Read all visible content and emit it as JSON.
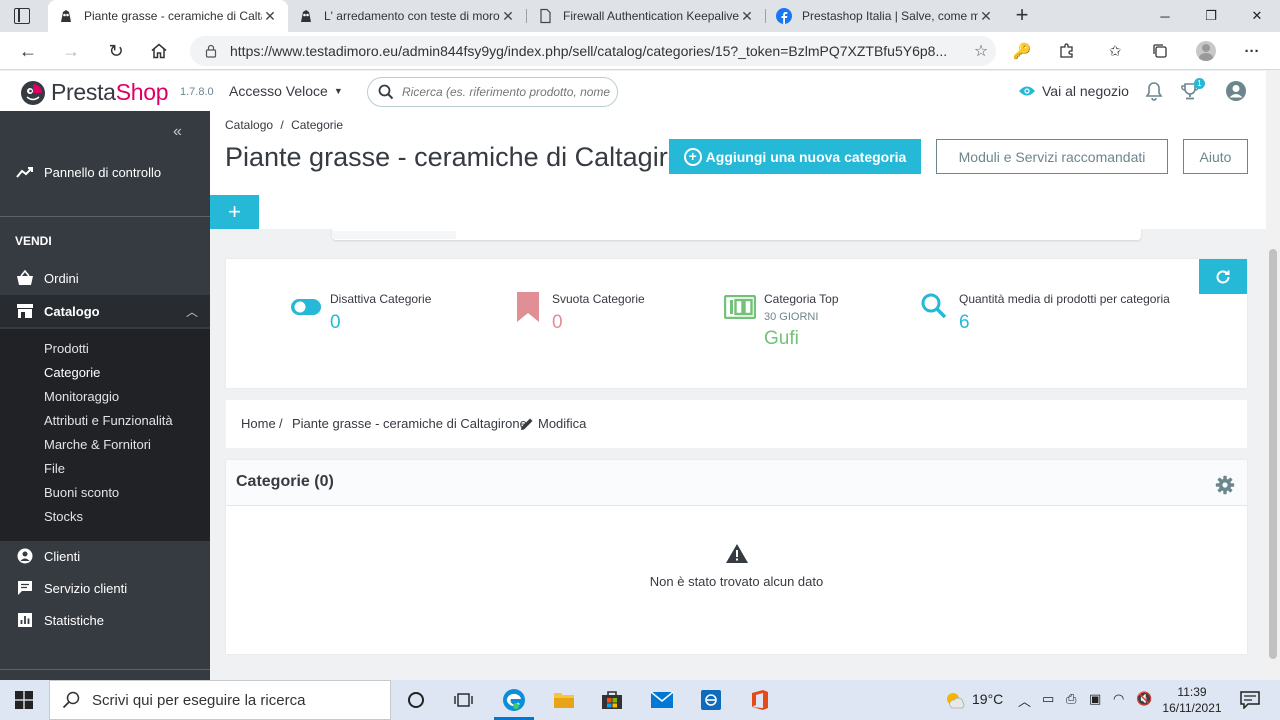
{
  "browser": {
    "tabs": [
      {
        "title": "Piante grasse - ceramiche di Caltagirone",
        "active": true,
        "favicon": "prestashop-head-icon"
      },
      {
        "title": "L' arredamento con teste di moro",
        "active": false,
        "favicon": "prestashop-head-icon"
      },
      {
        "title": "Firewall Authentication Keepalive",
        "active": false,
        "favicon": "page-icon"
      },
      {
        "title": "Prestashop Italia | Salve, come mi",
        "active": false,
        "favicon": "facebook-icon"
      }
    ],
    "url": "https://www.testadimoro.eu/admin844fsy9yg/index.php/sell/catalog/categories/15?_token=BzlmPQ7XZTBfu5Y6p8..."
  },
  "header": {
    "brand_a": "Presta",
    "brand_b": "Shop",
    "version": "1.7.8.0",
    "quick_access": "Accesso Veloce",
    "search_placeholder": "Ricerca (es. riferimento prodotto, nome",
    "shop_link": "Vai al negozio",
    "notification_count": "1"
  },
  "sidebar": {
    "dashboard": "Pannello di controllo",
    "section": "VENDI",
    "orders": "Ordini",
    "catalog": "Catalogo",
    "catalog_sub": [
      "Prodotti",
      "Categorie",
      "Monitoraggio",
      "Attributi e Funzionalità",
      "Marche & Fornitori",
      "File",
      "Buoni sconto",
      "Stocks"
    ],
    "customers": "Clienti",
    "customer_service": "Servizio clienti",
    "stats": "Statistiche"
  },
  "page": {
    "crumb_1": "Catalogo",
    "crumb_2": "Categorie",
    "title": "Piante grasse - ceramiche di Caltagirone",
    "add_button": "Aggiungi una nuova categoria",
    "modules_button": "Moduli e Servizi raccomandati",
    "help_button": "Aiuto"
  },
  "kpis": [
    {
      "label": "Disattiva Categorie",
      "sub": "",
      "value": "0",
      "color": "#25b9d7",
      "icon": "toggle-icon"
    },
    {
      "label": "Svuota Categorie",
      "sub": "",
      "value": "0",
      "color": "#e08f95",
      "icon": "bookmark-icon"
    },
    {
      "label": "Categoria Top",
      "sub": "30 GIORNI",
      "value": "Gufi",
      "color": "#72c279",
      "icon": "hundred-icon"
    },
    {
      "label": "Quantità media di prodotti per categoria",
      "sub": "",
      "value": "6",
      "color": "#25b9d7",
      "icon": "search-icon"
    }
  ],
  "breadcrumb": {
    "home": "Home",
    "category": "Piante grasse - ceramiche di Caltagirone",
    "edit": "Modifica"
  },
  "panel": {
    "title": "Categorie (0)",
    "empty_message": "Non è stato trovato alcun dato"
  },
  "taskbar": {
    "search_placeholder": "Scrivi qui per eseguire la ricerca",
    "weather": "19°C",
    "time": "11:39",
    "date": "16/11/2021"
  },
  "colors": {
    "accent": "#25b9d7",
    "sidebar": "#363a41",
    "brand_pink": "#df0067"
  }
}
